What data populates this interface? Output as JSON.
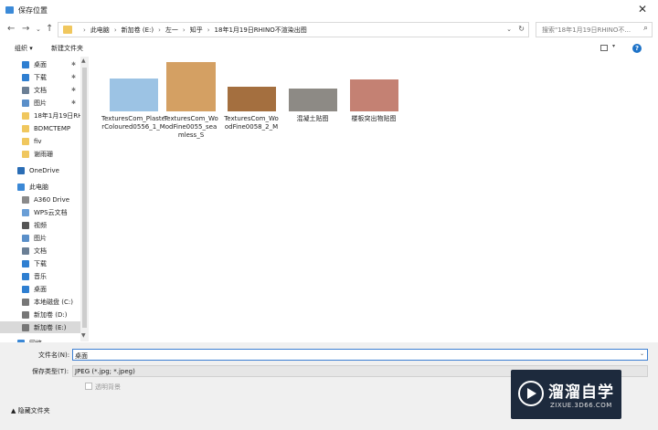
{
  "window": {
    "title": "保存位置",
    "close_glyph": "✕"
  },
  "nav": {
    "back": "←",
    "forward": "→",
    "recent": "⌄",
    "up": "↑",
    "crumbs": [
      "此电脑",
      "新加卷 (E:)",
      "左一",
      "知乎",
      "18年1月19日RHINO不渲染出图"
    ],
    "crumb_sep": "›",
    "dropdown_glyph": "⌄",
    "refresh_glyph": "↻",
    "search_placeholder": "搜索\"18年1月19日RHINO不...",
    "search_glyph": "⌕"
  },
  "toolbar": {
    "organize": "组织 ▾",
    "new_folder": "新建文件夹",
    "view_dd": "▾",
    "help": "?"
  },
  "sidebar": {
    "items": [
      {
        "label": "桌面",
        "icon": "desktop-icon",
        "color": "#2f7fd1",
        "pinned": true
      },
      {
        "label": "下载",
        "icon": "download-icon",
        "color": "#2f7fd1",
        "pinned": true
      },
      {
        "label": "文档",
        "icon": "document-icon",
        "color": "#6b7f95",
        "pinned": true
      },
      {
        "label": "图片",
        "icon": "picture-icon",
        "color": "#5a8fc9",
        "pinned": true
      },
      {
        "label": "18年1月19日RH",
        "icon": "folder-icon",
        "color": "#f0c75e",
        "pinned": false
      },
      {
        "label": "BDMCTEMP",
        "icon": "folder-icon",
        "color": "#f0c75e",
        "pinned": false
      },
      {
        "label": "fiv",
        "icon": "folder-icon",
        "color": "#f0c75e",
        "pinned": false
      },
      {
        "label": "谢雨珊",
        "icon": "folder-icon",
        "color": "#f0c75e",
        "pinned": false
      },
      {
        "label": "OneDrive",
        "icon": "cloud-icon",
        "color": "#2a6db5",
        "pinned": false
      },
      {
        "label": "此电脑",
        "icon": "computer-icon",
        "color": "#3b88d6",
        "pinned": false
      },
      {
        "label": "A360 Drive",
        "icon": "drive-icon",
        "color": "#8a8a8a",
        "pinned": false
      },
      {
        "label": "WPS云文档",
        "icon": "wps-cloud-icon",
        "color": "#6a9ed6",
        "pinned": false
      },
      {
        "label": "视频",
        "icon": "video-icon",
        "color": "#555555",
        "pinned": false
      },
      {
        "label": "图片",
        "icon": "picture-icon",
        "color": "#5a8fc9",
        "pinned": false
      },
      {
        "label": "文档",
        "icon": "document-icon",
        "color": "#6b7f95",
        "pinned": false
      },
      {
        "label": "下载",
        "icon": "download-icon",
        "color": "#2f7fd1",
        "pinned": false
      },
      {
        "label": "音乐",
        "icon": "music-icon",
        "color": "#2f7fd1",
        "pinned": false
      },
      {
        "label": "桌面",
        "icon": "desktop-icon",
        "color": "#2f7fd1",
        "pinned": false
      },
      {
        "label": "本地磁盘 (C:)",
        "icon": "disk-icon",
        "color": "#777777",
        "pinned": false
      },
      {
        "label": "新加卷 (D:)",
        "icon": "disk-icon",
        "color": "#777777",
        "pinned": false
      },
      {
        "label": "新加卷 (E:)",
        "icon": "disk-icon",
        "color": "#777777",
        "pinned": false,
        "selected": true
      },
      {
        "label": "网络",
        "icon": "network-icon",
        "color": "#3b88d6",
        "pinned": false
      }
    ],
    "pin_glyph": "✱",
    "scroll_up": "▲",
    "scroll_down": "▼"
  },
  "files": [
    {
      "label": "TexturesCom_PlasterColoured0556_1_M",
      "thumb": "blue-plaster-thumbnail",
      "color": "#9cc3e4"
    },
    {
      "label": "TexturesCom_WoodFine0055_seamless_S",
      "thumb": "light-wood-thumbnail",
      "color": "#d4a063"
    },
    {
      "label": "TexturesCom_WoodFine0058_2_M",
      "thumb": "brown-wood-thumbnail",
      "color": "#a46f3f"
    },
    {
      "label": "混凝土贴图",
      "thumb": "concrete-thumbnail",
      "color": "#8d8a85"
    },
    {
      "label": "楼板突出物贴图",
      "thumb": "brick-thumbnail",
      "color": "#c48173"
    }
  ],
  "bottom": {
    "filename_label": "文件名(N):",
    "filename_value": "桌面",
    "filetype_label": "保存类型(T):",
    "filetype_value": "JPEG (*.jpg; *.jpeg)",
    "transparent_label": "透明背景",
    "hide_folders": "▲ 隐藏文件夹",
    "dropdown_glyph": "⌄"
  },
  "watermark": {
    "brand": "溜溜自学",
    "url": "ZIXUE.3D66.COM"
  }
}
